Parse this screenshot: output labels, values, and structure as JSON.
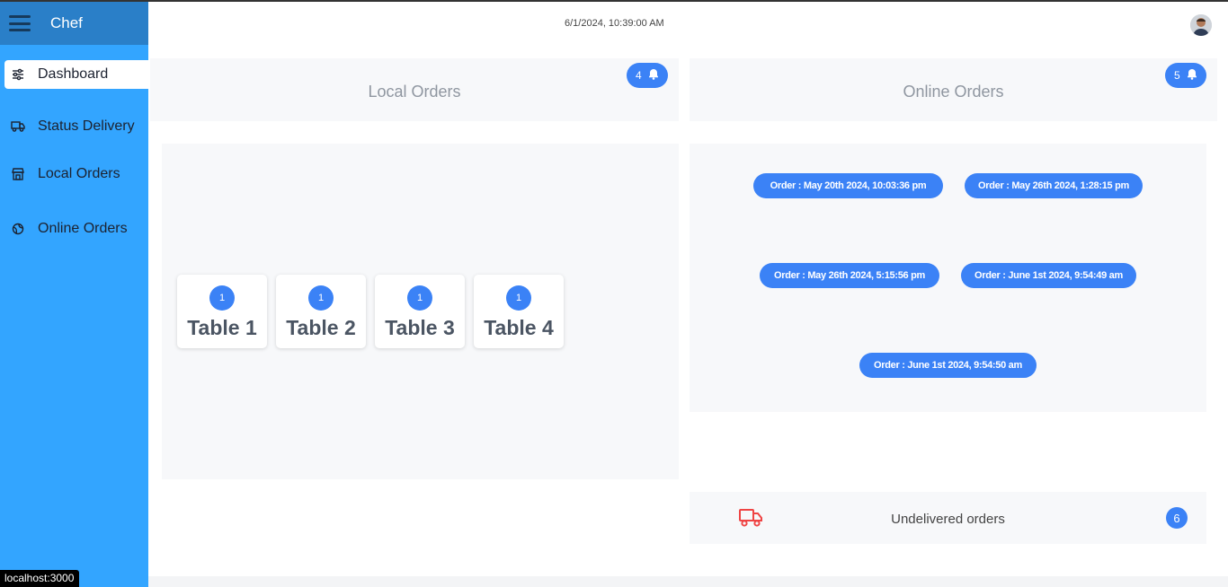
{
  "sidebar": {
    "brand": "Chef",
    "items": [
      {
        "label": "Dashboard",
        "icon": "sliders-icon"
      },
      {
        "label": "Status Delivery",
        "icon": "truck-icon"
      },
      {
        "label": "Local Orders",
        "icon": "store-icon"
      },
      {
        "label": "Online Orders",
        "icon": "globe-icon"
      }
    ]
  },
  "header": {
    "datetime": "6/1/2024, 10:39:00 AM"
  },
  "local_orders": {
    "title": "Local Orders",
    "badge_count": "4",
    "tables": [
      {
        "count": "1",
        "name": "Table 1"
      },
      {
        "count": "1",
        "name": "Table 2"
      },
      {
        "count": "1",
        "name": "Table 3"
      },
      {
        "count": "1",
        "name": "Table 4"
      }
    ]
  },
  "online_orders": {
    "title": "Online Orders",
    "badge_count": "5",
    "orders": [
      "Order :   May 20th 2024, 10:03:36 pm",
      "Order :   May 26th 2024, 1:28:15 pm",
      "Order :   May 26th 2024, 5:15:56 pm",
      "Order :   June 1st 2024, 9:54:49 am",
      "Order :   June 1st 2024, 9:54:50 am"
    ]
  },
  "undelivered": {
    "label": "Undelivered orders",
    "count": "6"
  },
  "status_bar": {
    "url": "localhost:3000"
  },
  "colors": {
    "sidebar": "#33a5ff",
    "sidebar_header": "#2a7fc8",
    "accent": "#3b82f6",
    "truck": "#ef4444"
  }
}
